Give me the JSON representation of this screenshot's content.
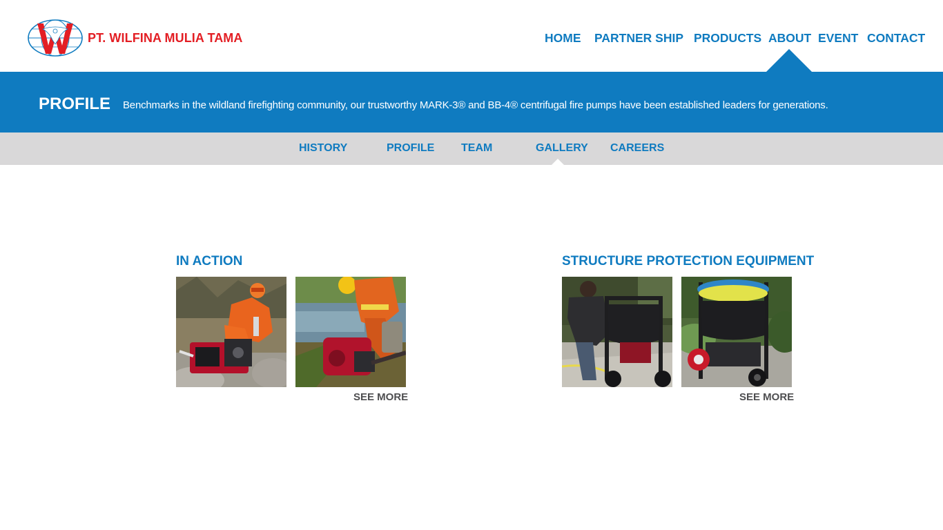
{
  "header": {
    "brand_name": "PT. WILFINA MULIA TAMA",
    "logo_icon": "globe-eagle-logo",
    "nav": [
      {
        "label": "HOME"
      },
      {
        "label": "PARTNER SHIP"
      },
      {
        "label": "PRODUCTS"
      },
      {
        "label": "ABOUT",
        "active": true
      },
      {
        "label": "EVENT"
      },
      {
        "label": "CONTACT"
      }
    ]
  },
  "banner": {
    "title": "PROFILE",
    "description": "Benchmarks in the wildland firefighting community, our trustworthy MARK-3® and BB-4® centrifugal fire pumps have been established leaders for generations."
  },
  "subnav": [
    {
      "label": "HISTORY"
    },
    {
      "label": "PROFILE"
    },
    {
      "label": "TEAM"
    },
    {
      "label": "GALLERY",
      "active": true
    },
    {
      "label": "CAREERS"
    }
  ],
  "gallery": [
    {
      "title": "IN ACTION",
      "see_more": "SEE MORE"
    },
    {
      "title": "STRUCTURE PROTECTION EQUIPMENT",
      "see_more": "SEE MORE"
    }
  ],
  "colors": {
    "brand_blue": "#0f7bc0",
    "brand_red": "#e31e24",
    "subnav_gray": "#d9d8d9",
    "see_more_gray": "#4e4e50"
  }
}
